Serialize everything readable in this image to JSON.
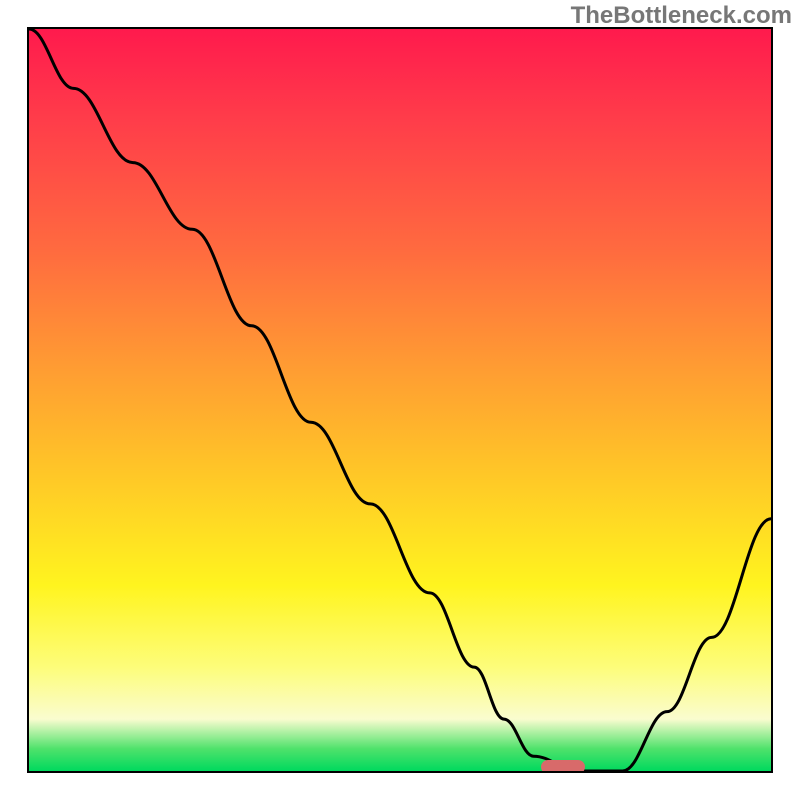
{
  "watermark": "TheBottleneck.com",
  "colors": {
    "gradient_top": "#ff1a4d",
    "gradient_mid1": "#ff9a33",
    "gradient_mid2": "#fff41f",
    "gradient_bottom": "#00d95e",
    "curve": "#000000",
    "marker": "#d86a6a",
    "border": "#000000"
  },
  "chart_data": {
    "type": "line",
    "title": "",
    "xlabel": "",
    "ylabel": "",
    "xlim": [
      0,
      100
    ],
    "ylim": [
      0,
      100
    ],
    "grid": false,
    "legend_position": "none",
    "series": [
      {
        "name": "bottleneck-curve",
        "x": [
          0,
          6,
          14,
          22,
          30,
          38,
          46,
          54,
          60,
          64,
          68,
          74,
          80,
          86,
          92,
          100
        ],
        "values": [
          100,
          92,
          82,
          73,
          60,
          47,
          36,
          24,
          14,
          7,
          2,
          0,
          0,
          8,
          18,
          34
        ]
      }
    ],
    "annotations": [
      {
        "name": "optimal-marker",
        "x": 72,
        "y": 0.5,
        "shape": "pill"
      }
    ],
    "notes": "x and y have no visible tick labels in the source image; values are estimated from curve geometry on a 0-100 normalized scale where y=0 is the bottom edge and y=100 is the top edge."
  }
}
